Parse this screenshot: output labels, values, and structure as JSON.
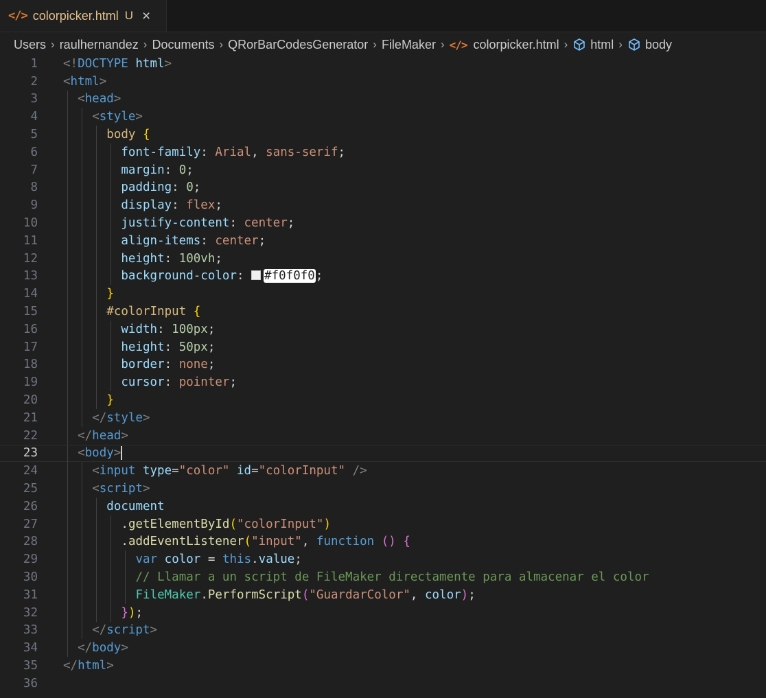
{
  "tab": {
    "icon": "code-icon",
    "filename": "colorpicker.html",
    "status": "U",
    "close": "×"
  },
  "breadcrumb": {
    "items": [
      "Users",
      "raulhernandez",
      "Documents",
      "QRorBarCodesGenerator",
      "FileMaker",
      "colorpicker.html",
      "html",
      "body"
    ],
    "separator": "›"
  },
  "editor": {
    "current_line": 23,
    "lines": [
      {
        "n": "1",
        "indent": 0,
        "tokens": [
          [
            "tk-punc",
            "<!"
          ],
          [
            "tk-doctype",
            "DOCTYPE"
          ],
          [
            "tk-plain",
            " "
          ],
          [
            "tk-attr",
            "html"
          ],
          [
            "tk-punc",
            ">"
          ]
        ]
      },
      {
        "n": "2",
        "indent": 0,
        "tokens": [
          [
            "tk-punc",
            "<"
          ],
          [
            "tk-tag",
            "html"
          ],
          [
            "tk-punc",
            ">"
          ]
        ]
      },
      {
        "n": "3",
        "indent": 1,
        "tokens": [
          [
            "tk-punc",
            "<"
          ],
          [
            "tk-tag",
            "head"
          ],
          [
            "tk-punc",
            ">"
          ]
        ]
      },
      {
        "n": "4",
        "indent": 2,
        "tokens": [
          [
            "tk-punc",
            "<"
          ],
          [
            "tk-tag",
            "style"
          ],
          [
            "tk-punc",
            ">"
          ]
        ]
      },
      {
        "n": "5",
        "indent": 3,
        "tokens": [
          [
            "tk-sel",
            "body"
          ],
          [
            "tk-plain",
            " "
          ],
          [
            "tk-brace",
            "{"
          ]
        ]
      },
      {
        "n": "6",
        "indent": 4,
        "tokens": [
          [
            "tk-prop",
            "font-family"
          ],
          [
            "tk-plain",
            ": "
          ],
          [
            "tk-val",
            "Arial"
          ],
          [
            "tk-plain",
            ", "
          ],
          [
            "tk-val",
            "sans-serif"
          ],
          [
            "tk-plain",
            ";"
          ]
        ]
      },
      {
        "n": "7",
        "indent": 4,
        "tokens": [
          [
            "tk-prop",
            "margin"
          ],
          [
            "tk-plain",
            ": "
          ],
          [
            "tk-num",
            "0"
          ],
          [
            "tk-plain",
            ";"
          ]
        ]
      },
      {
        "n": "8",
        "indent": 4,
        "tokens": [
          [
            "tk-prop",
            "padding"
          ],
          [
            "tk-plain",
            ": "
          ],
          [
            "tk-num",
            "0"
          ],
          [
            "tk-plain",
            ";"
          ]
        ]
      },
      {
        "n": "9",
        "indent": 4,
        "tokens": [
          [
            "tk-prop",
            "display"
          ],
          [
            "tk-plain",
            ": "
          ],
          [
            "tk-val",
            "flex"
          ],
          [
            "tk-plain",
            ";"
          ]
        ]
      },
      {
        "n": "10",
        "indent": 4,
        "tokens": [
          [
            "tk-prop",
            "justify-content"
          ],
          [
            "tk-plain",
            ": "
          ],
          [
            "tk-val",
            "center"
          ],
          [
            "tk-plain",
            ";"
          ]
        ]
      },
      {
        "n": "11",
        "indent": 4,
        "tokens": [
          [
            "tk-prop",
            "align-items"
          ],
          [
            "tk-plain",
            ": "
          ],
          [
            "tk-val",
            "center"
          ],
          [
            "tk-plain",
            ";"
          ]
        ]
      },
      {
        "n": "12",
        "indent": 4,
        "tokens": [
          [
            "tk-prop",
            "height"
          ],
          [
            "tk-plain",
            ": "
          ],
          [
            "tk-num",
            "100vh"
          ],
          [
            "tk-plain",
            ";"
          ]
        ]
      },
      {
        "n": "13",
        "indent": 4,
        "tokens": [
          [
            "tk-prop",
            "background-color"
          ],
          [
            "tk-plain",
            ": "
          ],
          [
            "swatch",
            ""
          ],
          [
            "hex-hl",
            "#f0f0f0"
          ],
          [
            "tk-plain",
            ";"
          ]
        ]
      },
      {
        "n": "14",
        "indent": 3,
        "tokens": [
          [
            "tk-brace",
            "}"
          ]
        ]
      },
      {
        "n": "15",
        "indent": 3,
        "tokens": [
          [
            "tk-sel",
            "#colorInput"
          ],
          [
            "tk-plain",
            " "
          ],
          [
            "tk-brace",
            "{"
          ]
        ]
      },
      {
        "n": "16",
        "indent": 4,
        "tokens": [
          [
            "tk-prop",
            "width"
          ],
          [
            "tk-plain",
            ": "
          ],
          [
            "tk-num",
            "100px"
          ],
          [
            "tk-plain",
            ";"
          ]
        ]
      },
      {
        "n": "17",
        "indent": 4,
        "tokens": [
          [
            "tk-prop",
            "height"
          ],
          [
            "tk-plain",
            ": "
          ],
          [
            "tk-num",
            "50px"
          ],
          [
            "tk-plain",
            ";"
          ]
        ]
      },
      {
        "n": "18",
        "indent": 4,
        "tokens": [
          [
            "tk-prop",
            "border"
          ],
          [
            "tk-plain",
            ": "
          ],
          [
            "tk-val",
            "none"
          ],
          [
            "tk-plain",
            ";"
          ]
        ]
      },
      {
        "n": "19",
        "indent": 4,
        "tokens": [
          [
            "tk-prop",
            "cursor"
          ],
          [
            "tk-plain",
            ": "
          ],
          [
            "tk-val",
            "pointer"
          ],
          [
            "tk-plain",
            ";"
          ]
        ]
      },
      {
        "n": "20",
        "indent": 3,
        "tokens": [
          [
            "tk-brace",
            "}"
          ]
        ]
      },
      {
        "n": "21",
        "indent": 2,
        "tokens": [
          [
            "tk-punc",
            "</"
          ],
          [
            "tk-tag",
            "style"
          ],
          [
            "tk-punc",
            ">"
          ]
        ]
      },
      {
        "n": "22",
        "indent": 1,
        "tokens": [
          [
            "tk-punc",
            "</"
          ],
          [
            "tk-tag",
            "head"
          ],
          [
            "tk-punc",
            ">"
          ]
        ]
      },
      {
        "n": "23",
        "indent": 1,
        "tokens": [
          [
            "tk-punc",
            "<"
          ],
          [
            "tk-tag",
            "body"
          ],
          [
            "tk-punc",
            ">"
          ],
          [
            "cursor",
            ""
          ]
        ]
      },
      {
        "n": "24",
        "indent": 2,
        "tokens": [
          [
            "tk-punc",
            "<"
          ],
          [
            "tk-tag",
            "input"
          ],
          [
            "tk-plain",
            " "
          ],
          [
            "tk-attr",
            "type"
          ],
          [
            "tk-plain",
            "="
          ],
          [
            "tk-str",
            "\"color\""
          ],
          [
            "tk-plain",
            " "
          ],
          [
            "tk-attr",
            "id"
          ],
          [
            "tk-plain",
            "="
          ],
          [
            "tk-str",
            "\"colorInput\""
          ],
          [
            "tk-plain",
            " "
          ],
          [
            "tk-punc",
            "/>"
          ]
        ]
      },
      {
        "n": "25",
        "indent": 2,
        "tokens": [
          [
            "tk-punc",
            "<"
          ],
          [
            "tk-tag",
            "script"
          ],
          [
            "tk-punc",
            ">"
          ]
        ]
      },
      {
        "n": "26",
        "indent": 3,
        "tokens": [
          [
            "tk-var",
            "document"
          ]
        ]
      },
      {
        "n": "27",
        "indent": 4,
        "tokens": [
          [
            "tk-plain",
            "."
          ],
          [
            "tk-fn",
            "getElementById"
          ],
          [
            "tk-brace",
            "("
          ],
          [
            "tk-str",
            "\"colorInput\""
          ],
          [
            "tk-brace",
            ")"
          ]
        ]
      },
      {
        "n": "28",
        "indent": 4,
        "tokens": [
          [
            "tk-plain",
            "."
          ],
          [
            "tk-fn",
            "addEventListener"
          ],
          [
            "tk-brace",
            "("
          ],
          [
            "tk-str",
            "\"input\""
          ],
          [
            "tk-plain",
            ", "
          ],
          [
            "tk-kw",
            "function"
          ],
          [
            "tk-plain",
            " "
          ],
          [
            "tk-paren2",
            "()"
          ],
          [
            "tk-plain",
            " "
          ],
          [
            "tk-paren2",
            "{"
          ]
        ]
      },
      {
        "n": "29",
        "indent": 5,
        "tokens": [
          [
            "tk-kw",
            "var"
          ],
          [
            "tk-plain",
            " "
          ],
          [
            "tk-var",
            "color"
          ],
          [
            "tk-plain",
            " = "
          ],
          [
            "tk-kw",
            "this"
          ],
          [
            "tk-plain",
            "."
          ],
          [
            "tk-var",
            "value"
          ],
          [
            "tk-plain",
            ";"
          ]
        ]
      },
      {
        "n": "30",
        "indent": 5,
        "tokens": [
          [
            "tk-comment",
            "// Llamar a un script de FileMaker directamente para almacenar el color"
          ]
        ]
      },
      {
        "n": "31",
        "indent": 5,
        "tokens": [
          [
            "tk-cls",
            "FileMaker"
          ],
          [
            "tk-plain",
            "."
          ],
          [
            "tk-fn",
            "PerformScript"
          ],
          [
            "tk-paren2",
            "("
          ],
          [
            "tk-str",
            "\"GuardarColor\""
          ],
          [
            "tk-plain",
            ", "
          ],
          [
            "tk-var",
            "color"
          ],
          [
            "tk-paren2",
            ")"
          ],
          [
            "tk-plain",
            ";"
          ]
        ]
      },
      {
        "n": "32",
        "indent": 4,
        "tokens": [
          [
            "tk-paren2",
            "}"
          ],
          [
            "tk-brace",
            ")"
          ],
          [
            "tk-plain",
            ";"
          ]
        ]
      },
      {
        "n": "33",
        "indent": 2,
        "tokens": [
          [
            "tk-punc",
            "</"
          ],
          [
            "tk-tag",
            "script"
          ],
          [
            "tk-punc",
            ">"
          ]
        ]
      },
      {
        "n": "34",
        "indent": 1,
        "tokens": [
          [
            "tk-punc",
            "</"
          ],
          [
            "tk-tag",
            "body"
          ],
          [
            "tk-punc",
            ">"
          ]
        ]
      },
      {
        "n": "35",
        "indent": 0,
        "tokens": [
          [
            "tk-punc",
            "</"
          ],
          [
            "tk-tag",
            "html"
          ],
          [
            "tk-punc",
            ">"
          ]
        ]
      },
      {
        "n": "36",
        "indent": 0,
        "tokens": []
      }
    ]
  }
}
